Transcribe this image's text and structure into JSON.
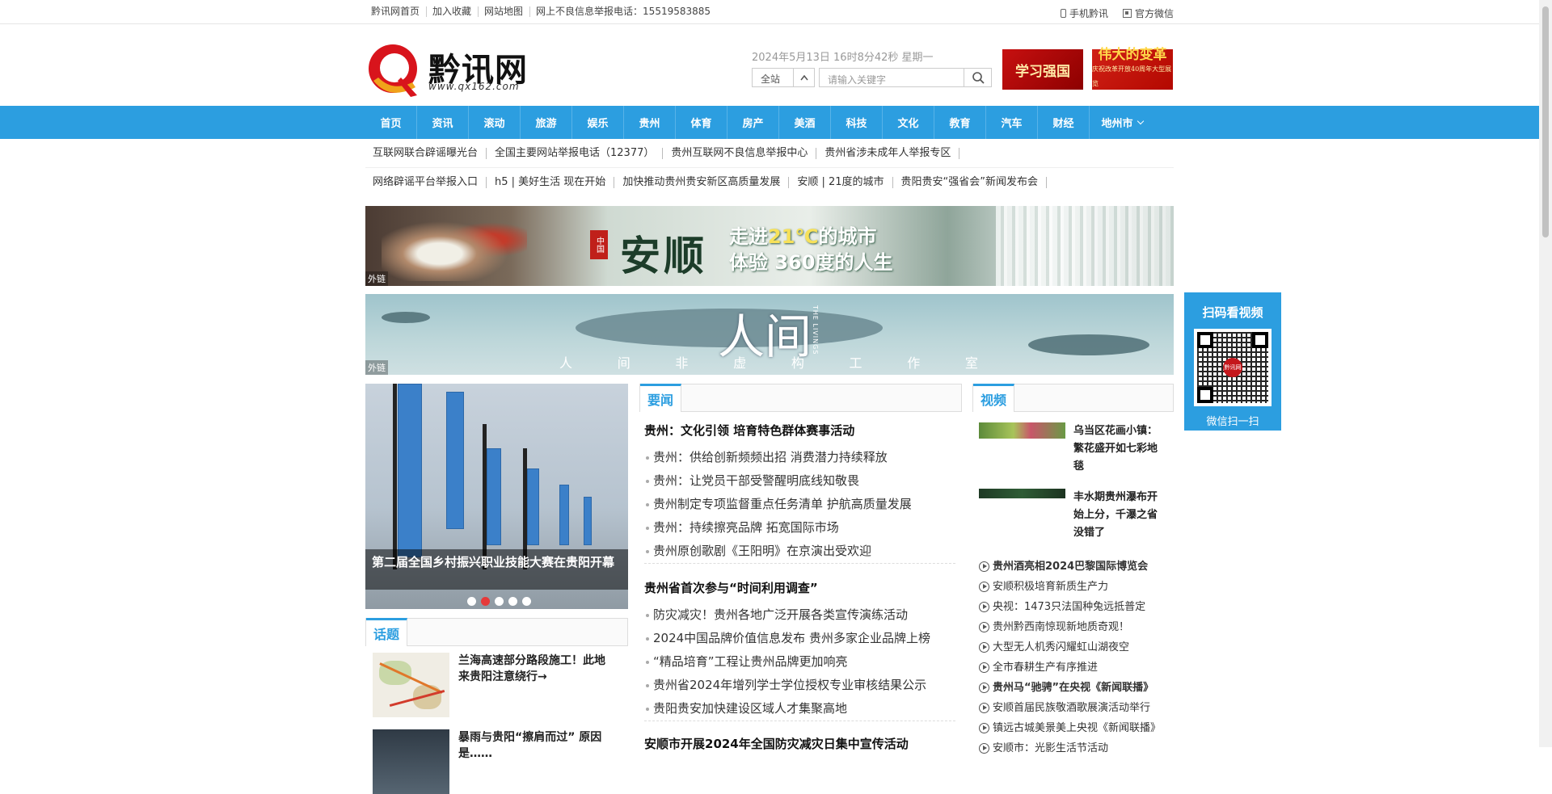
{
  "topbar": {
    "links": [
      "黔讯网首页",
      "加入收藏",
      "网站地图",
      "网上不良信息举报电话：15519583885"
    ],
    "mobile": "手机黔讯",
    "wechat": "官方微信"
  },
  "header": {
    "logo_text": "黔讯网",
    "logo_url_text": "www.qx162.com",
    "datetime": "2024年5月13日 16时8分42秒 星期一",
    "search_scope": "全站",
    "search_placeholder": "请输入关键字",
    "promo1": "学习强国",
    "promo2": "伟大的变革",
    "promo2_sub": "庆祝改革开放40周年大型展览"
  },
  "nav": [
    "首页",
    "资讯",
    "滚动",
    "旅游",
    "娱乐",
    "贵州",
    "体育",
    "房产",
    "美酒",
    "科技",
    "文化",
    "教育",
    "汽车",
    "财经"
  ],
  "nav_more": "地州市",
  "link_row1": [
    "互联网联合辟谣曝光台",
    "全国主要网站举报电话（12377）",
    "贵州互联网不良信息举报中心",
    "贵州省涉未成年人举报专区"
  ],
  "link_row2": [
    "网络辟谣平台举报入口",
    "h5 | 美好生活 现在开始",
    "加快推动贵州贵安新区高质量发展",
    "安顺 | 21度的城市",
    "贵阳贵安“强省会”新闻发布会"
  ],
  "banner1": {
    "title": "安顺",
    "seal": "中国",
    "line1_a": "走进",
    "line1_b": "21℃",
    "line1_c": "的城市",
    "line2": "体验 360度的人生",
    "tag": "外链"
  },
  "banner2": {
    "title": "人间",
    "en": "THE LIVINGS",
    "sub": [
      "人",
      "间",
      "非",
      "虚",
      "构",
      "工",
      "作",
      "室"
    ],
    "tag": "外链"
  },
  "qr": {
    "title": "扫码看视频",
    "logo": "黔讯网",
    "caption": "微信扫一扫"
  },
  "slide": {
    "caption": "第二届全国乡村振兴职业技能大赛在贵阳开幕",
    "dots": 5,
    "active": 1
  },
  "yaowen": {
    "tab": "要闻",
    "group1_head": "贵州：文化引领 培育特色群体赛事活动",
    "group1": [
      "贵州：供给创新频频出招 消费潜力持续释放",
      "贵州：让党员干部受警醒明底线知敬畏",
      "贵州制定专项监督重点任务清单 护航高质量发展",
      "贵州：持续擦亮品牌 拓宽国际市场",
      "贵州原创歌剧《王阳明》在京演出受欢迎"
    ],
    "group2_head": "贵州省首次参与“时间利用调查”",
    "group2": [
      "防灾减灾！贵州各地广泛开展各类宣传演练活动",
      "2024中国品牌价值信息发布 贵州多家企业品牌上榜",
      "“精品培育”工程让贵州品牌更加响亮",
      "贵州省2024年增列学士学位授权专业审核结果公示",
      "贵阳贵安加快建设区域人才集聚高地"
    ],
    "group3_head": "安顺市开展2024年全国防灾减灾日集中宣传活动"
  },
  "huati": {
    "tab": "话题",
    "items": [
      "兰海高速部分路段施工！此地来贵阳注意绕行→",
      "暴雨与贵阳“擦肩而过” 原因是……"
    ]
  },
  "video": {
    "tab": "视频",
    "featured": [
      "乌当区花画小镇：繁花盛开如七彩地毯",
      "丰水期贵州瀑布开始上分，千瀑之省没错了"
    ],
    "list": [
      {
        "text": "贵州酒亮相2024巴黎国际博览会",
        "bold": true
      },
      {
        "text": "安顺积极培育新质生产力",
        "bold": false
      },
      {
        "text": "央视：1473只法国种兔远抵普定",
        "bold": false
      },
      {
        "text": "贵州黔西南惊现新地质奇观！",
        "bold": false
      },
      {
        "text": "大型无人机秀闪耀虹山湖夜空",
        "bold": false
      },
      {
        "text": "全市春耕生产有序推进",
        "bold": false
      },
      {
        "text": "贵州马“驰骋”在央视《新闻联播》",
        "bold": true
      },
      {
        "text": "安顺首届民族敬酒歌展演活动举行",
        "bold": false
      },
      {
        "text": "镇远古城美景美上央视《新闻联播》",
        "bold": false
      },
      {
        "text": "安顺市：光影生活节活动",
        "bold": false
      }
    ]
  }
}
